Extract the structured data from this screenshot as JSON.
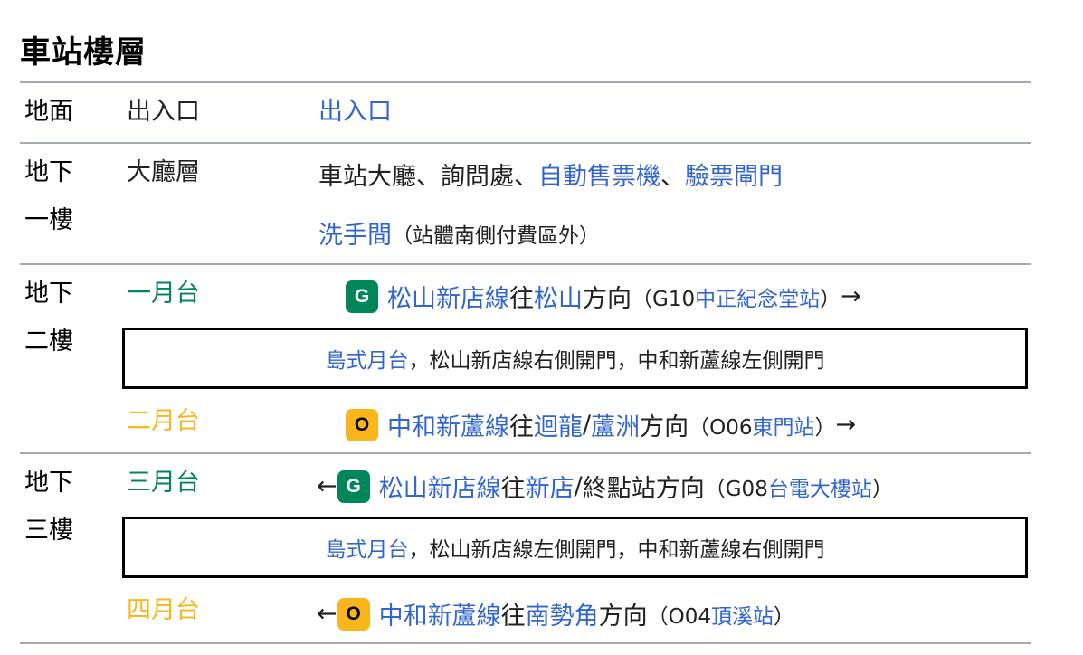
{
  "title": "車站樓層",
  "rows": {
    "ground": {
      "level": "地面",
      "label": "出入口",
      "content_link": "出入口"
    },
    "b1": {
      "level_line1": "地下",
      "level_line2": "一樓",
      "label": "大廳層",
      "line1_text": "車站大廳、詢問處、",
      "line1_link1": "自動售票機",
      "line1_sep": "、",
      "line1_link2": "驗票閘門",
      "line2_link": "洗手間",
      "line2_note": "（站體南側付費區外）"
    },
    "b2": {
      "level_line1": "地下",
      "level_line2": "二樓",
      "p1": {
        "label": "一月台",
        "badge": "G",
        "line_name": "松山新店線",
        "dir_prefix": " 往",
        "dest_link": "松山",
        "dir_suffix": "方向",
        "paren_open": "（G10 ",
        "next_link": "中正紀念堂站",
        "paren_close": "）",
        "arrow": "→"
      },
      "island": {
        "link": "島式月台",
        "text": "，松山新店線右側開門，中和新蘆線左側開門"
      },
      "p2": {
        "label": "二月台",
        "badge": "O",
        "line_name": "中和新蘆線",
        "dir_prefix": " 往",
        "dest_link1": "迴龍",
        "slash": " / ",
        "dest_link2": "蘆洲",
        "dir_suffix": "方向",
        "paren_open": "（O06 ",
        "next_link": "東門站",
        "paren_close": "）",
        "arrow": "→"
      }
    },
    "b3": {
      "level_line1": "地下",
      "level_line2": "三樓",
      "p3": {
        "label": "三月台",
        "arrow": "←",
        "badge": "G",
        "line_name": "松山新店線",
        "dir_prefix": " 往",
        "dest_link": "新店",
        "slash": " / ",
        "dir_suffix": "終點站方向",
        "paren_open": "（G08 ",
        "next_link": "台電大樓站",
        "paren_close": "）"
      },
      "island": {
        "link": "島式月台",
        "text": "，松山新店線左側開門，中和新蘆線右側開門"
      },
      "p4": {
        "label": "四月台",
        "arrow": "←",
        "badge": "O",
        "line_name": "中和新蘆線",
        "dir_prefix": " 往",
        "dest_link": "南勢角",
        "dir_suffix": "方向",
        "paren_open": "（O04 ",
        "next_link": "頂溪站",
        "paren_close": "）"
      }
    }
  },
  "colors": {
    "green_line": "#008659",
    "orange_line": "#f8b61c",
    "link": "#3366cc",
    "rule": "#a2a9b1"
  }
}
